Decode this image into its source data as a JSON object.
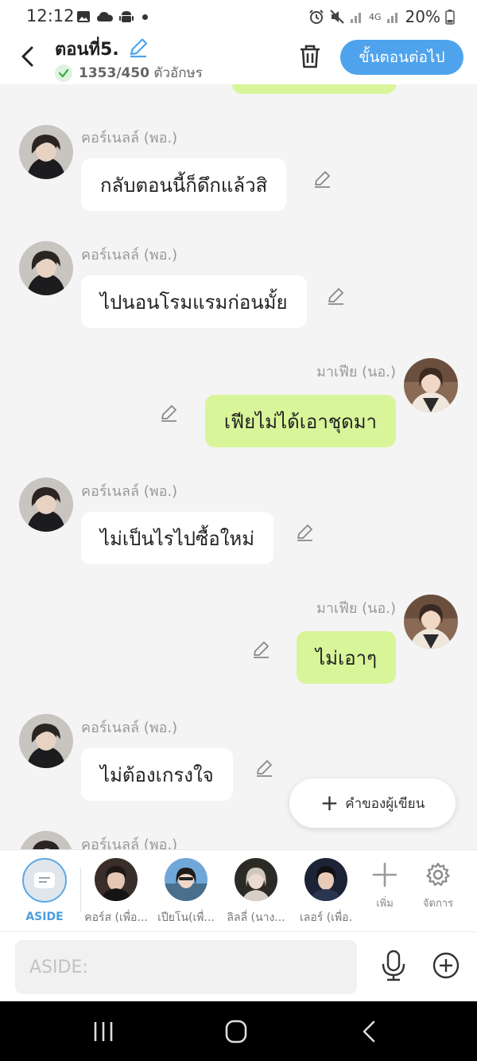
{
  "status_bar": {
    "time": "12:12",
    "network": "4G",
    "battery": "20%"
  },
  "header": {
    "episode_title": "ตอนที่5.",
    "char_count": "1353/450",
    "char_unit": "ตัวอักษร",
    "next_button": "ขั้นตอนต่อไป"
  },
  "messages": [
    {
      "side": "left",
      "name": "คอร์เนลล์ (พอ.)",
      "text": "กลับตอนนี้ก็ดึกแล้วสิ"
    },
    {
      "side": "left",
      "name": "คอร์เนลล์ (พอ.)",
      "text": "ไปนอนโรมแรมก่อนมั้ย"
    },
    {
      "side": "right",
      "name": "มาเฟีย (นอ.)",
      "text": "เฟียไม่ได้เอาชุดมา"
    },
    {
      "side": "left",
      "name": "คอร์เนลล์ (พอ.)",
      "text": "ไม่เป็นไรไปซื้อใหม่"
    },
    {
      "side": "right",
      "name": "มาเฟีย (นอ.)",
      "text": "ไม่เอาๆ"
    },
    {
      "side": "left",
      "name": "คอร์เนลล์ (พอ.)",
      "text": "ไม่ต้องเกรงใจ"
    },
    {
      "side": "left",
      "name": "คอร์เนลล์ (พอ.)",
      "text": ""
    }
  ],
  "fab": {
    "label": "คำของผู้เขียน"
  },
  "characters": [
    {
      "label": "ASIDE"
    },
    {
      "label": "คอร์ส (เพื่อ..."
    },
    {
      "label": "เปียโน(เพื่..."
    },
    {
      "label": "ลิลลี่ (นาง..."
    },
    {
      "label": "เลอร์ (เพื่อ."
    }
  ],
  "tools": {
    "add_label": "เพิ่ม",
    "manage_label": "จัดการ"
  },
  "input": {
    "placeholder": "ASIDE:"
  },
  "colors": {
    "accent": "#4ea3ec",
    "right_bubble": "#d9f59a",
    "left_bubble": "#ffffff",
    "background": "#f4f4f4"
  }
}
